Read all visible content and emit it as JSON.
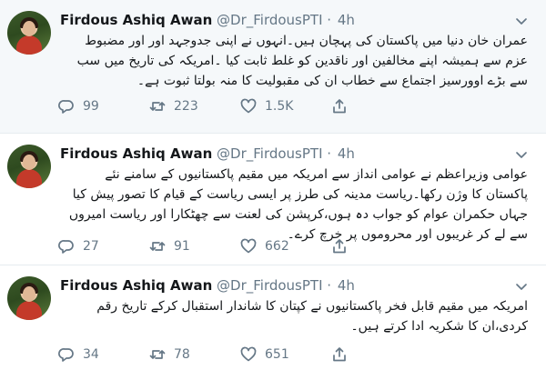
{
  "tweets": [
    {
      "name": "Firdous Ashiq Awan",
      "handle": "@Dr_FirdousPTI",
      "separator": "·",
      "time": "4h",
      "text": "عمران خان دنیا میں پاکستان کی پہچان ہیں۔انہوں نے اپنی جدوجہد اور اور مضبوط عزم سے ہمیشہ اپنے مخالفین اور ناقدین کو غلط ثابت کیا ۔امریکہ کی تاریخ میں سب سے بڑے اوورسیز اجتماع سے خطاب ان کی مقبولیت کا منہ بولتا ثبوت ہے۔",
      "replies": "99",
      "retweets": "223",
      "likes": "1.5K"
    },
    {
      "name": "Firdous Ashiq Awan",
      "handle": "@Dr_FirdousPTI",
      "separator": "·",
      "time": "4h",
      "text": "عوامی وزیراعظم نے عوامی انداز سے امریکہ میں مقیم پاکستانیوں کے سامنے نئے پاکستان کا وژن رکھا۔ریاست مدینہ کی طرز پر ایسی ریاست کے قیام کا تصور پیش کیا جہاں حکمران عوام کو جواب دہ ہوں،کرپشن کی لعنت سے چھٹکارا اور ریاست امیروں سے لے کر غریبوں اور محروموں پر خرچ کرے۔",
      "replies": "27",
      "retweets": "91",
      "likes": "662"
    },
    {
      "name": "Firdous Ashiq Awan",
      "handle": "@Dr_FirdousPTI",
      "separator": "·",
      "time": "4h",
      "text": "امریکہ میں مقیم قابل فخر پاکستانیوں نے کپتان کا شاندار استقبال کرکے تاریخ رقم کردی،ان کا شکریہ ادا کرتے ہیں۔",
      "replies": "34",
      "retweets": "78",
      "likes": "651"
    }
  ],
  "icons": {
    "reply": "reply-icon",
    "retweet": "retweet-icon",
    "like": "like-icon",
    "share": "share-icon",
    "caret": "chevron-down-icon"
  },
  "colors": {
    "highlight_background": "#f5f8fa",
    "secondary_text": "#657786",
    "divider": "#e6ecf0"
  }
}
